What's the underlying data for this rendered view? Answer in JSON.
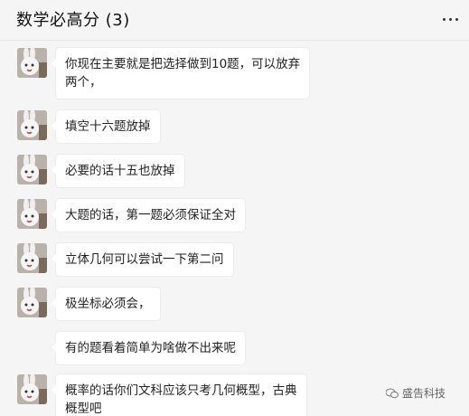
{
  "header": {
    "title": "数学必高分 (3)",
    "more_icon": "more-horizontal-icon"
  },
  "messages": [
    {
      "text": "你现在主要就是把选择做到10题，可以放弃\n两个，",
      "avatar": "rabbit-avatar"
    },
    {
      "text": "填空十六题放掉",
      "avatar": "rabbit-avatar"
    },
    {
      "text": "必要的话十五也放掉",
      "avatar": "rabbit-avatar"
    },
    {
      "text": "大题的话，第一题必须保证全对",
      "avatar": "rabbit-avatar"
    },
    {
      "text": "立体几何可以尝试一下第二问",
      "avatar": "rabbit-avatar"
    },
    {
      "text": "极坐标必须会，",
      "avatar": "rabbit-avatar"
    },
    {
      "text": "有的题看着简单为啥做不出来呢",
      "avatar": "rabbit-avatar"
    },
    {
      "text": "概率的话你们文科应该只考几何概型，古典\n概型吧",
      "avatar": "rabbit-avatar"
    }
  ],
  "watermark": {
    "text": "盛告科技",
    "icon": "wechat-logo-icon"
  },
  "colors": {
    "background": "#f5f5f5",
    "bubble": "#ffffff",
    "text": "#222222"
  }
}
